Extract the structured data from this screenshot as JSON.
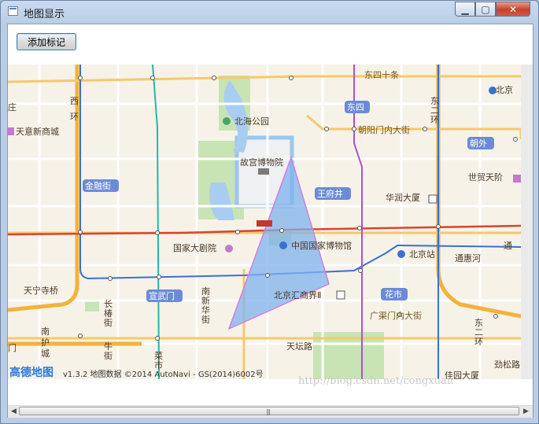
{
  "window": {
    "title": "地图显示"
  },
  "toolbar": {
    "add_marker_label": "添加标记"
  },
  "map": {
    "logo": "高德地图",
    "attribution": "v1.3.2 地图数据 ©2014 AutoNavi - GS(2014)6002号",
    "labels": {
      "dongsishitiao": "东四十条",
      "beijingzhan_tr": "北京",
      "zhuang": "庄",
      "beihai": "北海公园",
      "dongsi": "东四",
      "xi": "西",
      "huan": "环",
      "dong_v1": "东",
      "dong_v2": "二",
      "dong_v3": "环",
      "chaoyangmen": "朝阳门内大街",
      "tianyi": "天意新商城",
      "gugong": "故宫博物院",
      "chaowai": "朝外",
      "shimao": "世贸天阶",
      "jinrongjie": "金融街",
      "wangfujing": "王府井",
      "huarun": "华润大厦",
      "guojiadajuyuan": "国家大剧院",
      "guojiabowuguan": "中国国家博物馆",
      "beijingzhan": "北京站",
      "tong": "通",
      "tonghuihe": "通惠河",
      "tianningsi": "天宁寺桥",
      "xuanwumen": "宣武门",
      "nanxin1": "南",
      "nanxin2": "新",
      "nanxin3": "华",
      "nanxin4": "街",
      "beijinghuijie": "北京汇商界Ⅱ",
      "huashi": "花市",
      "changchun1": "长",
      "changchun2": "椿",
      "changchun3": "街",
      "guangqumen": "广渠门内大街",
      "dongerhuan2_1": "东",
      "dongerhuan2_2": "二",
      "dongerhuan2_3": "环",
      "tiantanlu": "天坛路",
      "nanhucheng1": "南",
      "nanhucheng2": "护",
      "nanhucheng3": "城",
      "niujie1": "牛",
      "niujie2": "街",
      "caishi1": "菜",
      "caishi2": "市",
      "men": "门",
      "jinsong": "劲松路",
      "tuanjiehu": "佳园大厦"
    }
  },
  "watermark": "http://blog.csdn.net/congxuan",
  "colors": {
    "polygon_fill": "#7fb2ee",
    "polygon_stroke": "#d17fe0",
    "ring_road": "#f2b23c",
    "line_red": "#d64531",
    "line_blue": "#3b6fd1",
    "line_purple": "#b14fcf",
    "line_teal": "#25b6a9"
  }
}
